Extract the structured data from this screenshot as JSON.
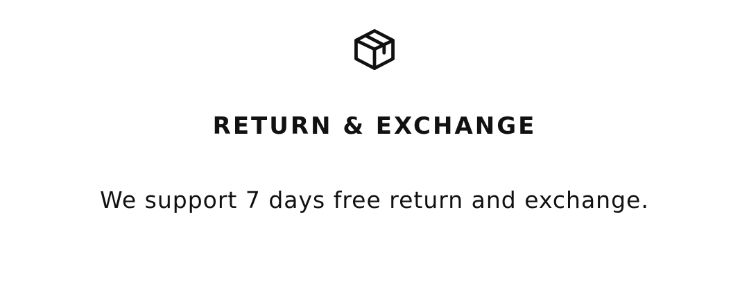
{
  "section": {
    "icon": "package-box-icon",
    "title": "RETURN & EXCHANGE",
    "description": "We support 7 days free return and exchange."
  },
  "colors": {
    "background": "#ffffff",
    "text": "#111111"
  }
}
